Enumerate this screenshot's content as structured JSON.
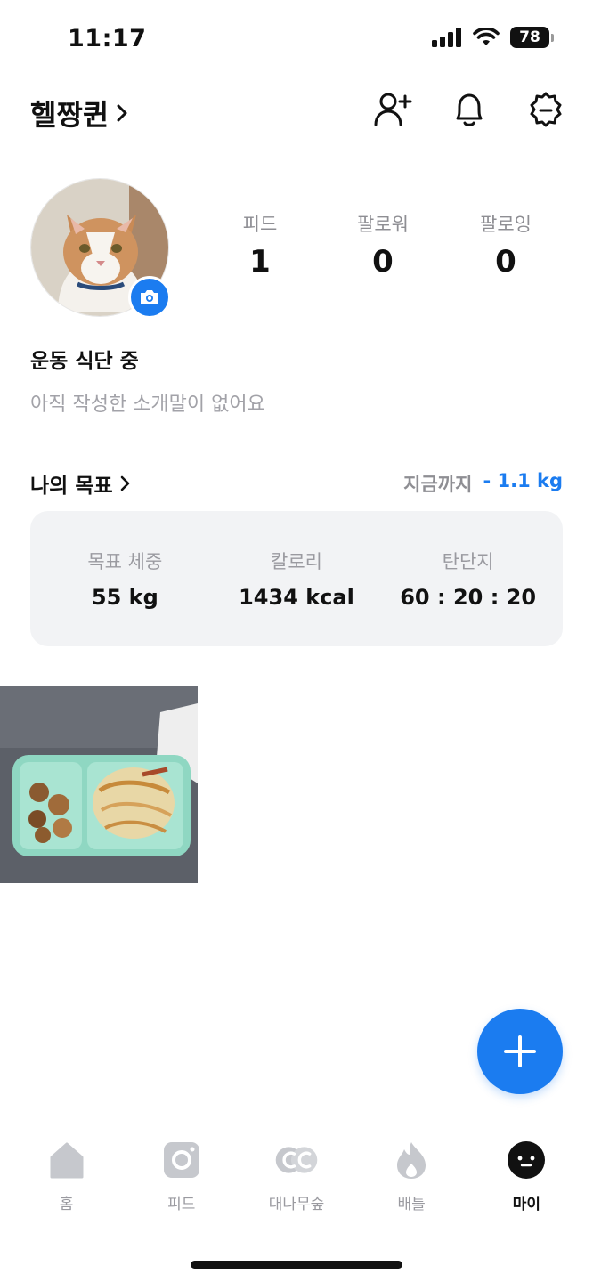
{
  "status_bar": {
    "time": "11:17",
    "battery": "78"
  },
  "header": {
    "username": "헬짱퀸",
    "chevron": "›",
    "icons": [
      "add-friend-icon",
      "bell-icon",
      "settings-icon"
    ]
  },
  "profile": {
    "stats": [
      {
        "label": "피드",
        "value": "1"
      },
      {
        "label": "팔로워",
        "value": "0"
      },
      {
        "label": "팔로잉",
        "value": "0"
      }
    ],
    "name": "운동 식단 중",
    "bio": "아직 작성한 소개말이 없어요"
  },
  "goals": {
    "title": "나의 목표",
    "progress_label": "지금까지",
    "progress_value": "- 1.1 kg",
    "items": [
      {
        "label": "목표 체중",
        "value": "55 kg"
      },
      {
        "label": "칼로리",
        "value": "1434 kcal"
      },
      {
        "label": "탄단지",
        "value": "60 : 20 : 20"
      }
    ]
  },
  "bottom_nav": {
    "items": [
      {
        "label": "홈",
        "icon": "home-icon"
      },
      {
        "label": "피드",
        "icon": "feed-icon"
      },
      {
        "label": "대나무숲",
        "icon": "bamboo-icon"
      },
      {
        "label": "배틀",
        "icon": "flame-icon"
      },
      {
        "label": "마이",
        "icon": "profile-face-icon",
        "active": true
      }
    ]
  },
  "colors": {
    "accent": "#1b7cf0",
    "muted": "#8e8e93",
    "card_bg": "#f2f3f5"
  }
}
